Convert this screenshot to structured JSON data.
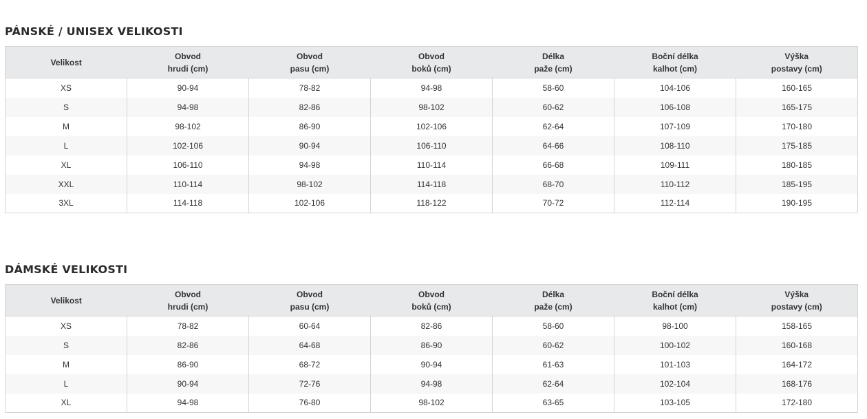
{
  "tables": [
    {
      "title": "PÁNSKÉ / UNISEX VELIKOSTI",
      "headers": [
        [
          "Velikost"
        ],
        [
          "Obvod",
          "hrudi (cm)"
        ],
        [
          "Obvod",
          "pasu (cm)"
        ],
        [
          "Obvod",
          "boků (cm)"
        ],
        [
          "Délka",
          "paže (cm)"
        ],
        [
          "Boční délka",
          "kalhot (cm)"
        ],
        [
          "Výška",
          "postavy (cm)"
        ]
      ],
      "rows": [
        [
          "XS",
          "90-94",
          "78-82",
          "94-98",
          "58-60",
          "104-106",
          "160-165"
        ],
        [
          "S",
          "94-98",
          "82-86",
          "98-102",
          "60-62",
          "106-108",
          "165-175"
        ],
        [
          "M",
          "98-102",
          "86-90",
          "102-106",
          "62-64",
          "107-109",
          "170-180"
        ],
        [
          "L",
          "102-106",
          "90-94",
          "106-110",
          "64-66",
          "108-110",
          "175-185"
        ],
        [
          "XL",
          "106-110",
          "94-98",
          "110-114",
          "66-68",
          "109-111",
          "180-185"
        ],
        [
          "XXL",
          "110-114",
          "98-102",
          "114-118",
          "68-70",
          "110-112",
          "185-195"
        ],
        [
          "3XL",
          "114-118",
          "102-106",
          "118-122",
          "70-72",
          "112-114",
          "190-195"
        ]
      ]
    },
    {
      "title": "DÁMSKÉ VELIKOSTI",
      "headers": [
        [
          "Velikost"
        ],
        [
          "Obvod",
          "hrudi (cm)"
        ],
        [
          "Obvod",
          "pasu (cm)"
        ],
        [
          "Obvod",
          "boků (cm)"
        ],
        [
          "Délka",
          "paže (cm)"
        ],
        [
          "Boční délka",
          "kalhot (cm)"
        ],
        [
          "Výška",
          "postavy (cm)"
        ]
      ],
      "rows": [
        [
          "XS",
          "78-82",
          "60-64",
          "82-86",
          "58-60",
          "98-100",
          "158-165"
        ],
        [
          "S",
          "82-86",
          "64-68",
          "86-90",
          "60-62",
          "100-102",
          "160-168"
        ],
        [
          "M",
          "86-90",
          "68-72",
          "90-94",
          "61-63",
          "101-103",
          "164-172"
        ],
        [
          "L",
          "90-94",
          "72-76",
          "94-98",
          "62-64",
          "102-104",
          "168-176"
        ],
        [
          "XL",
          "94-98",
          "76-80",
          "98-102",
          "63-65",
          "103-105",
          "172-180"
        ]
      ]
    }
  ]
}
